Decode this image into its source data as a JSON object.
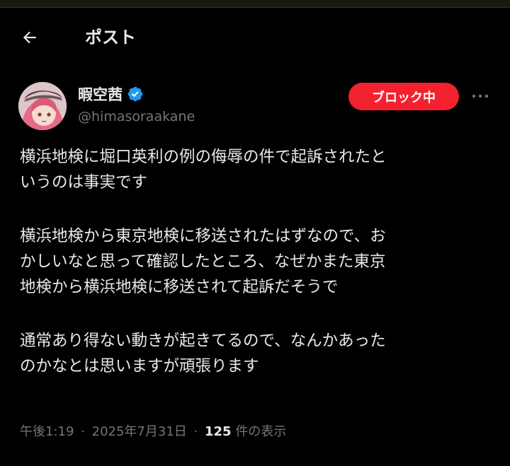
{
  "header": {
    "title": "ポスト"
  },
  "user": {
    "display_name": "暇空茜",
    "handle": "@himasoraakane"
  },
  "actions": {
    "blocked_label": "ブロック中"
  },
  "post": {
    "paragraphs": [
      [
        "横浜地検に堀口英利の例の侮辱の件で起訴されたと",
        "いうのは事実です"
      ],
      [
        "横浜地検から東京地検に移送されたはずなので、お",
        "かしいなと思って確認したところ、なぜかまた東京",
        "地検から横浜地検に移送されて起訴だそうで"
      ],
      [
        "通常あり得ない動きが起きてるので、なんかあった",
        "のかなとは思いますが頑張ります"
      ]
    ]
  },
  "meta": {
    "time": "午後1:19",
    "separator": "·",
    "date": "2025年7月31日",
    "views_count": "125",
    "views_label": "件の表示"
  },
  "colors": {
    "background": "#000000",
    "text": "#e7e9ea",
    "secondary_text": "#71767b",
    "blocked_button": "#f4212e",
    "verified_badge": "#1d9bf0"
  },
  "icons": {
    "back": "arrow-left-icon",
    "verified": "verified-badge-icon",
    "more": "more-horizontal-icon"
  }
}
